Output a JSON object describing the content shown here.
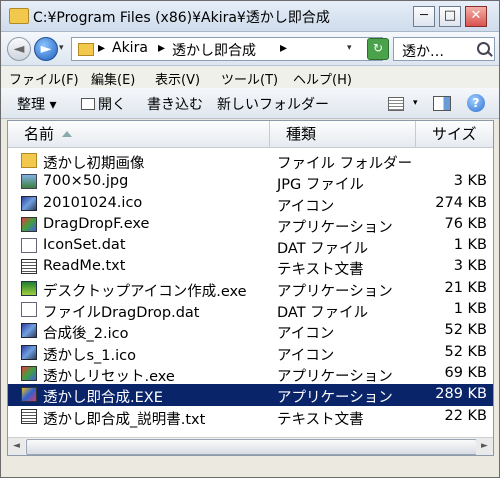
{
  "window": {
    "title": "C:¥Program Files (x86)¥Akira¥透かし即合成",
    "min_label": "─",
    "max_label": "□",
    "close_label": "✕"
  },
  "address": {
    "back_glyph": "◄",
    "forward_glyph": "►",
    "crumbs": [
      "Akira",
      "透かし即合成"
    ],
    "separator": "▸",
    "search_value": "透か…"
  },
  "menu": [
    "ファイル(F)",
    "編集(E)",
    "表示(V)",
    "ツール(T)",
    "ヘルプ(H)"
  ],
  "toolbar": {
    "organize": "整理 ▾",
    "open": "開く",
    "burn": "書き込む",
    "new_folder": "新しいフォルダー",
    "help_glyph": "?"
  },
  "columns": {
    "name": "名前",
    "type": "種類",
    "size": "サイズ"
  },
  "files": [
    {
      "name": "透かし初期画像",
      "type": "ファイル フォルダー",
      "size": "",
      "icon": "folder-icon"
    },
    {
      "name": "700×50.jpg",
      "type": "JPG ファイル",
      "size": "3 KB",
      "icon": "jpg-icon"
    },
    {
      "name": "20101024.ico",
      "type": "アイコン",
      "size": "274 KB",
      "icon": "ico-icon"
    },
    {
      "name": "DragDropF.exe",
      "type": "アプリケーション",
      "size": "76 KB",
      "icon": "exe-icon"
    },
    {
      "name": "IconSet.dat",
      "type": "DAT ファイル",
      "size": "1 KB",
      "icon": "dat-icon"
    },
    {
      "name": "ReadMe.txt",
      "type": "テキスト文書",
      "size": "3 KB",
      "icon": "txt-icon"
    },
    {
      "name": "デスクトップアイコン作成.exe",
      "type": "アプリケーション",
      "size": "21 KB",
      "icon": "exe-icon"
    },
    {
      "name": "ファイルDragDrop.dat",
      "type": "DAT ファイル",
      "size": "1 KB",
      "icon": "dat-icon"
    },
    {
      "name": "合成後_2.ico",
      "type": "アイコン",
      "size": "52 KB",
      "icon": "ico-icon"
    },
    {
      "name": "透かしs_1.ico",
      "type": "アイコン",
      "size": "52 KB",
      "icon": "ico-icon"
    },
    {
      "name": "透かしリセット.exe",
      "type": "アプリケーション",
      "size": "69 KB",
      "icon": "exe-icon"
    },
    {
      "name": "透かし即合成.EXE",
      "type": "アプリケーション",
      "size": "289 KB",
      "icon": "exe-icon",
      "selected": true
    },
    {
      "name": "透かし即合成_説明書.txt",
      "type": "テキスト文書",
      "size": "22 KB",
      "icon": "txt-icon"
    }
  ],
  "scrollbar": {
    "left_glyph": "◄",
    "right_glyph": "►"
  }
}
